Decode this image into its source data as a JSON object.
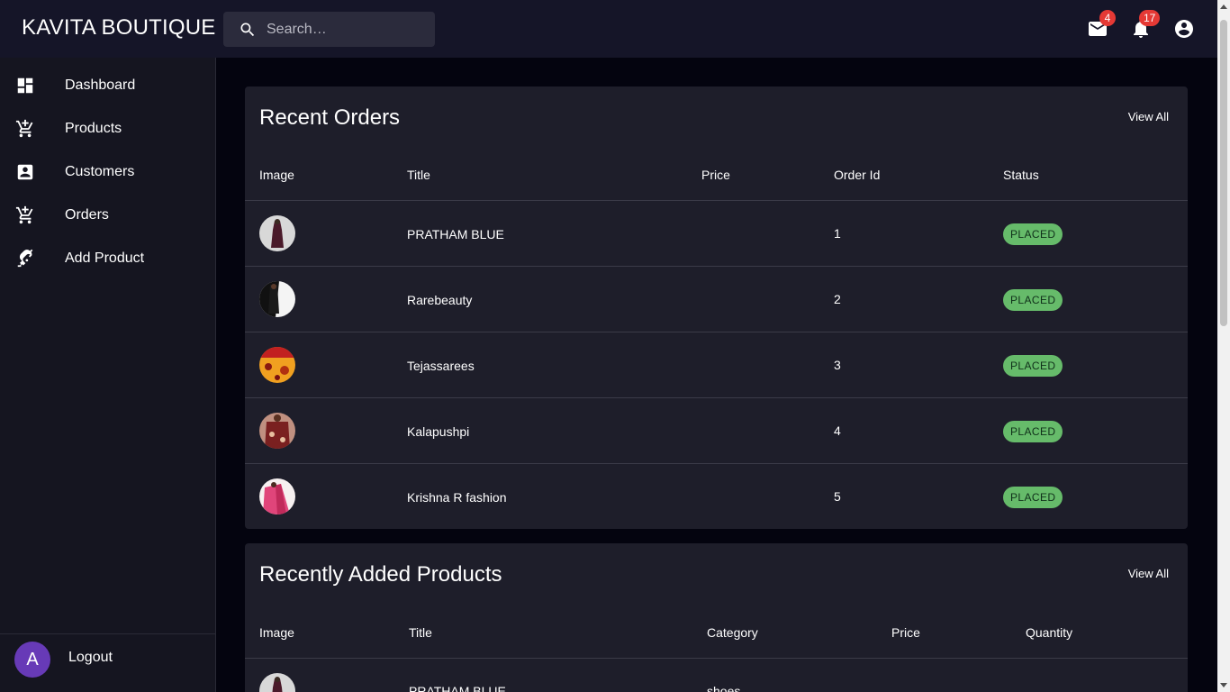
{
  "app": {
    "title": "KAVITA BOUTIQUE"
  },
  "search": {
    "placeholder": "Search…"
  },
  "topbar": {
    "mail_icon": "mail-icon",
    "mail_count": "4",
    "notifications_icon": "bell-icon",
    "notifications_count": "17",
    "account_icon": "account-circle-icon"
  },
  "sidebar": {
    "items": [
      {
        "label": "Dashboard",
        "icon": "dashboard-icon"
      },
      {
        "label": "Products",
        "icon": "cart-add-icon"
      },
      {
        "label": "Customers",
        "icon": "contact-card-icon"
      },
      {
        "label": "Orders",
        "icon": "cart-add-icon"
      },
      {
        "label": "Add Product",
        "icon": "precision-tool-icon"
      }
    ],
    "avatar_letter": "A",
    "logout_label": "Logout"
  },
  "recent_orders": {
    "title": "Recent Orders",
    "view_all": "View All",
    "columns": [
      "Image",
      "Title",
      "Price",
      "Order Id",
      "Status"
    ],
    "rows": [
      {
        "title": "PRATHAM BLUE",
        "price": "",
        "order_id": "1",
        "status": "PLACED"
      },
      {
        "title": "Rarebeauty",
        "price": "",
        "order_id": "2",
        "status": "PLACED"
      },
      {
        "title": "Tejassarees",
        "price": "",
        "order_id": "3",
        "status": "PLACED"
      },
      {
        "title": "Kalapushpi",
        "price": "",
        "order_id": "4",
        "status": "PLACED"
      },
      {
        "title": "Krishna R fashion",
        "price": "",
        "order_id": "5",
        "status": "PLACED"
      }
    ]
  },
  "recent_products": {
    "title": "Recently Added Products",
    "view_all": "View All",
    "columns": [
      "Image",
      "Title",
      "Category",
      "Price",
      "Quantity"
    ],
    "rows": [
      {
        "title": "PRATHAM BLUE",
        "category": "shoes",
        "price": "",
        "quantity": ""
      }
    ]
  },
  "colors": {
    "appbar": "#151528",
    "background": "#04040f",
    "card": "#1e1e2a",
    "status_placed": "#66bb6a",
    "badge": "#e53935",
    "avatar": "#673ab7"
  }
}
